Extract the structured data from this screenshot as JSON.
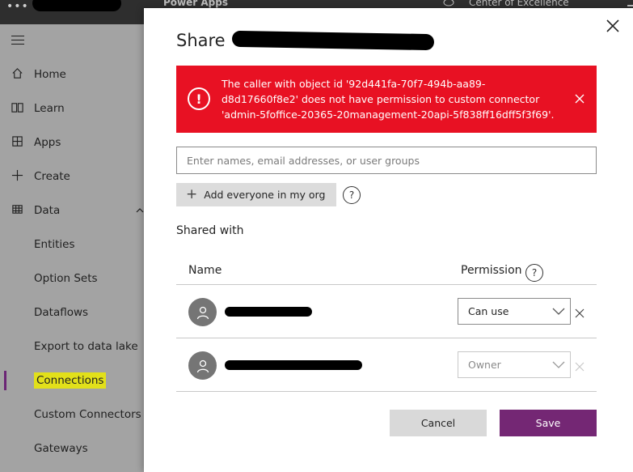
{
  "topbar": {
    "waffle": "•••",
    "app_name": "Power Apps",
    "environment_name": "Center of Excellence"
  },
  "sidebar": {
    "items": [
      {
        "label": "Home",
        "icon": "home-icon"
      },
      {
        "label": "Learn",
        "icon": "book-icon"
      },
      {
        "label": "Apps",
        "icon": "apps-icon"
      },
      {
        "label": "Create",
        "icon": "plus-icon"
      },
      {
        "label": "Data",
        "icon": "table-icon",
        "expanded": true
      },
      {
        "label": "Entities"
      },
      {
        "label": "Option Sets"
      },
      {
        "label": "Dataflows"
      },
      {
        "label": "Export to data lake"
      },
      {
        "label": "Connections",
        "active": true
      },
      {
        "label": "Custom Connectors"
      },
      {
        "label": "Gateways"
      }
    ]
  },
  "modal": {
    "title": "Share",
    "error": {
      "message": "The caller with object id '92d441fa-70f7-494b-aa89-d8d17660f8e2' does not have permission to custom connector 'admin-5foffice-20365-20management-20api-5f838ff16dff5f3f69'."
    },
    "people_picker": {
      "placeholder": "Enter names, email addresses, or user groups",
      "value": ""
    },
    "add_everyone_label": "Add everyone in my org",
    "shared_with_label": "Shared with",
    "table": {
      "columns": {
        "name": "Name",
        "permission": "Permission"
      },
      "rows": [
        {
          "permission": "Can use",
          "removable": true
        },
        {
          "permission": "Owner",
          "removable": false
        }
      ]
    },
    "buttons": {
      "cancel": "Cancel",
      "save": "Save"
    }
  },
  "colors": {
    "error_bg": "#e81123",
    "primary": "#742774",
    "active_nav": "#6b2575",
    "highlight": "#e2e01a"
  }
}
